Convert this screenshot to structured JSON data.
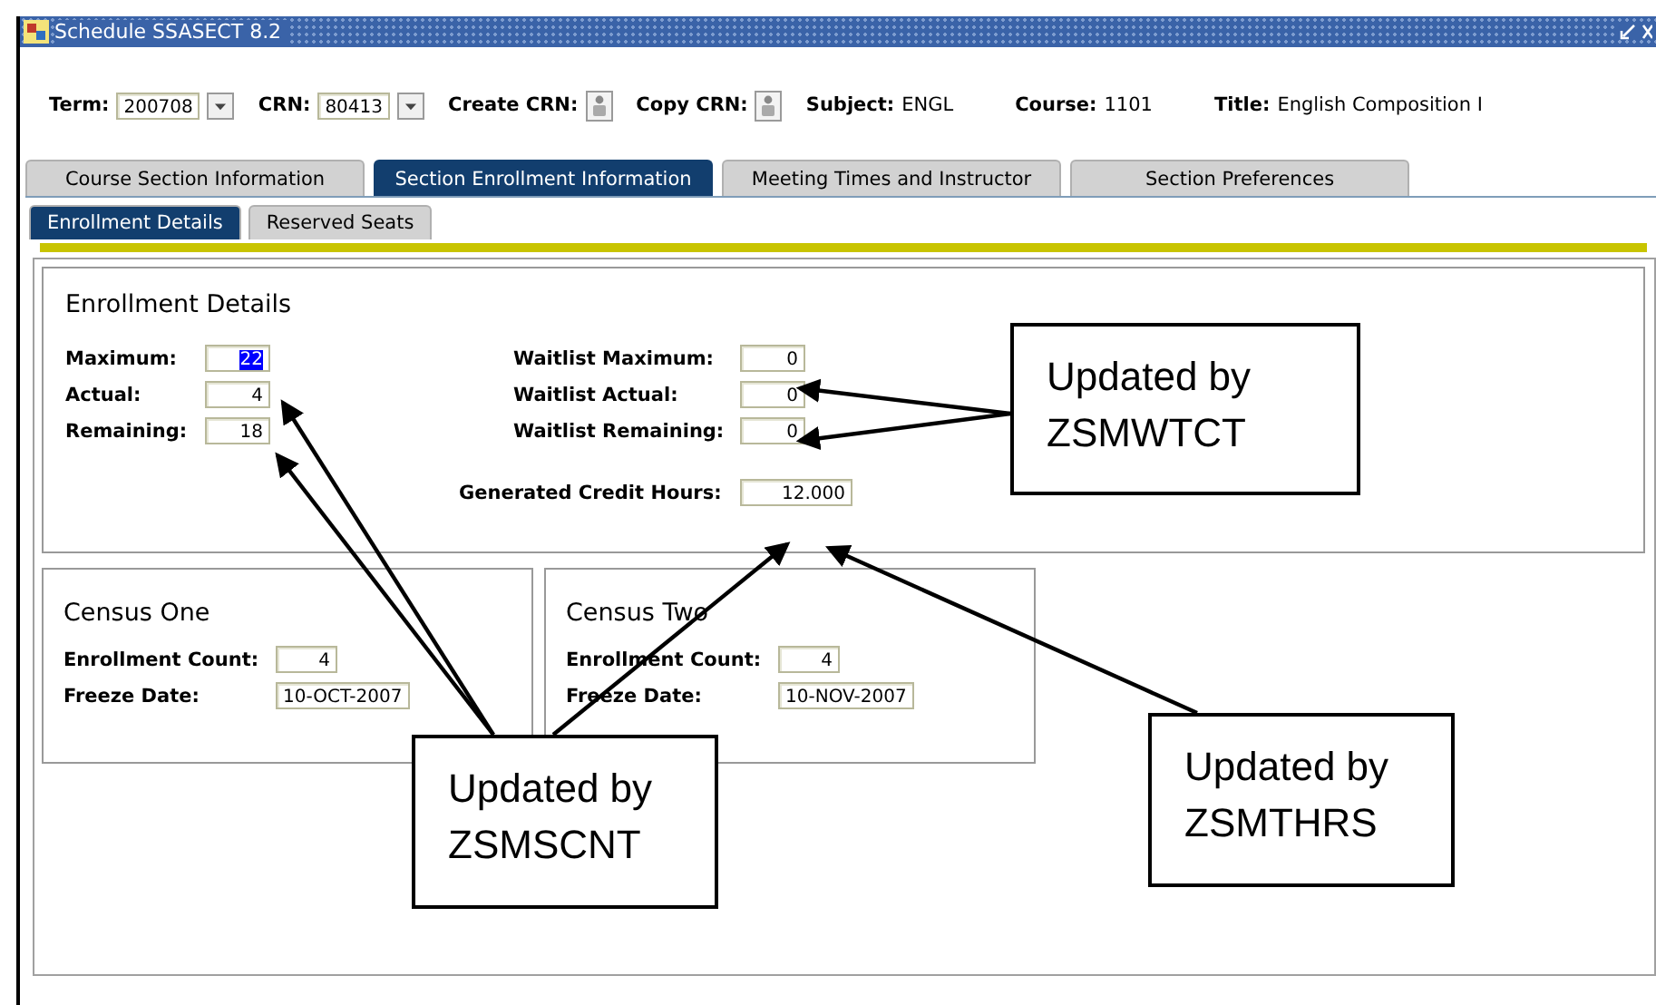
{
  "window": {
    "title": "Schedule SSASECT 8.2"
  },
  "key_block": [
    {
      "kind": "input",
      "label": "Term:",
      "value": "200708",
      "dropdown": true
    },
    {
      "kind": "input",
      "label": "CRN:",
      "value": "80413",
      "dropdown": true
    },
    {
      "kind": "button",
      "label": "Create CRN:"
    },
    {
      "kind": "button",
      "label": "Copy CRN:"
    },
    {
      "kind": "text",
      "label": "Subject:",
      "value": "ENGL"
    },
    {
      "kind": "text",
      "label": "Course:",
      "value": "1101"
    },
    {
      "kind": "text",
      "label": "Title:",
      "value": "English Composition I"
    }
  ],
  "tabs": [
    {
      "label": "Course Section Information",
      "selected": false
    },
    {
      "label": "Section Enrollment Information",
      "selected": true
    },
    {
      "label": "Meeting Times and Instructor",
      "selected": false
    },
    {
      "label": "Section Preferences",
      "selected": false
    }
  ],
  "subtabs": [
    {
      "label": "Enrollment Details",
      "selected": true
    },
    {
      "label": "Reserved Seats",
      "selected": false
    }
  ],
  "enrollment": {
    "title": "Enrollment Details",
    "left_fields": [
      {
        "label": "Maximum:",
        "value": "22",
        "text_selected": true
      },
      {
        "label": "Actual:",
        "value": "4",
        "text_selected": false
      },
      {
        "label": "Remaining:",
        "value": "18",
        "text_selected": false
      }
    ],
    "right_fields": [
      {
        "label": "Waitlist Maximum:",
        "value": "0",
        "text_selected": false
      },
      {
        "label": "Waitlist Actual:",
        "value": "0",
        "text_selected": false
      },
      {
        "label": "Waitlist Remaining:",
        "value": "0",
        "text_selected": false
      }
    ],
    "credit_hours": {
      "label": "Generated Credit Hours:",
      "value": "12.000"
    }
  },
  "census": [
    {
      "title": "Census One",
      "count_label": "Enrollment Count:",
      "count": "4",
      "date_label": "Freeze Date:",
      "date": "10-OCT-2007"
    },
    {
      "title": "Census Two",
      "count_label": "Enrollment Count:",
      "count": "4",
      "date_label": "Freeze Date:",
      "date": "10-NOV-2007"
    }
  ],
  "callouts": [
    {
      "lines": [
        "Updated by",
        "ZSMWTCT"
      ]
    },
    {
      "lines": [
        "Updated by",
        "ZSMSCNT"
      ]
    },
    {
      "lines": [
        "Updated by",
        "ZSMTHRS"
      ]
    }
  ]
}
